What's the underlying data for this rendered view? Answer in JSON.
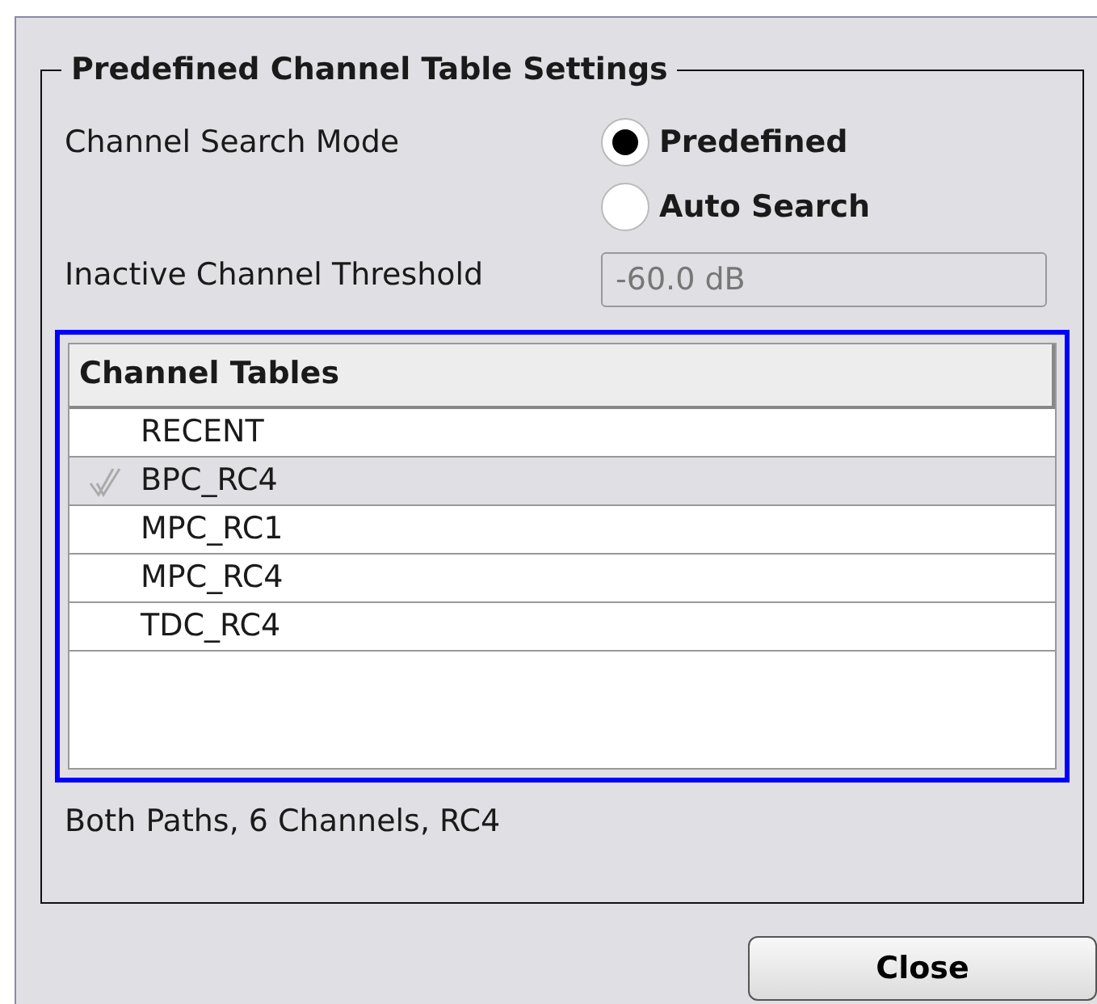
{
  "group": {
    "title": "Predefined Channel Table Settings"
  },
  "search_mode": {
    "label": "Channel Search Mode",
    "options": [
      {
        "label": "Predefined",
        "selected": true
      },
      {
        "label": "Auto Search",
        "selected": false
      }
    ]
  },
  "threshold": {
    "label": "Inactive Channel Threshold",
    "value": "-60.0 dB",
    "disabled": true
  },
  "table": {
    "column": "Channel Tables",
    "rows": [
      {
        "name": "RECENT",
        "selected": false,
        "checked": false
      },
      {
        "name": "BPC_RC4",
        "selected": true,
        "checked": true
      },
      {
        "name": "MPC_RC1",
        "selected": false,
        "checked": false
      },
      {
        "name": "MPC_RC4",
        "selected": false,
        "checked": false
      },
      {
        "name": "TDC_RC4",
        "selected": false,
        "checked": false
      }
    ]
  },
  "info": "Both Paths, 6 Channels, RC4",
  "buttons": [
    "Close"
  ]
}
